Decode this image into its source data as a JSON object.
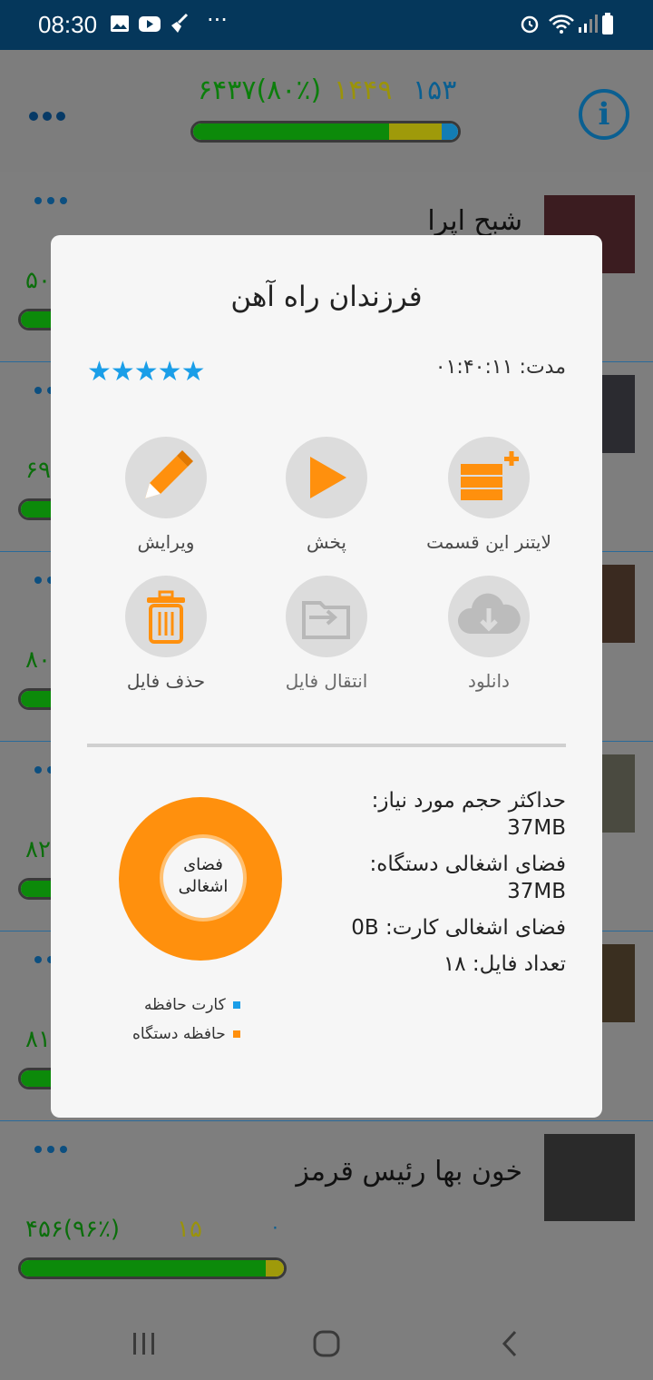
{
  "status_bar": {
    "time": "08:30",
    "overflow": "···"
  },
  "header": {
    "stat_green": "۶۴۳۷(۸۰٪)",
    "stat_yellow": "۱۴۴۹",
    "stat_blue": "۱۵۳",
    "progress": {
      "green": 0.74,
      "yellow": 0.2,
      "blue": 0.06
    }
  },
  "rows": [
    {
      "title": "شبح اپرا",
      "num": "۵۰"
    },
    {
      "title": "",
      "num": "۶۹"
    },
    {
      "title": "",
      "num": "۸۰"
    },
    {
      "title": "",
      "num": "۸۲"
    },
    {
      "title": "",
      "num": "۸۱"
    },
    {
      "title": "خون بها رئیس قرمز",
      "num": "۴۵۶(۹۶٪)",
      "yellow": "۱۵",
      "blue": "۰",
      "progress": {
        "green": 0.93,
        "yellow": 0.07
      }
    }
  ],
  "modal": {
    "title": "فرزندان راه آهن",
    "rating": 5,
    "duration_label": "مدت:",
    "duration_value": "۰۱:۴۰:۱۱",
    "actions": [
      {
        "label": "لایتنر این قسمت",
        "icon": "leitner-add-icon",
        "enabled": true
      },
      {
        "label": "پخش",
        "icon": "play-icon",
        "enabled": true
      },
      {
        "label": "ویرایش",
        "icon": "pencil-icon",
        "enabled": true
      },
      {
        "label": "دانلود",
        "icon": "cloud-download-icon",
        "enabled": false
      },
      {
        "label": "انتقال فایل",
        "icon": "folder-move-icon",
        "enabled": false
      },
      {
        "label": "حذف فایل",
        "icon": "trash-icon",
        "enabled": true
      }
    ],
    "info": {
      "max_size_label": "حداکثر حجم مورد نیاز:",
      "max_size_value": "37MB",
      "device_label": "فضای اشغالی دستگاه:",
      "device_value": "37MB",
      "card_label": "فضای اشغالی کارت:",
      "card_value": "0B",
      "files_label": "تعداد فایل:",
      "files_value": "۱۸"
    },
    "chart": {
      "center_line1": "فضای",
      "center_line2": "اشغالی",
      "legend": [
        {
          "label": "کارت حافظه",
          "color": "#1a9ee8"
        },
        {
          "label": "حافظه دستگاه",
          "color": "#ff900d"
        }
      ]
    }
  },
  "colors": {
    "accent": "#ff900d",
    "star": "#1a9ee8",
    "status_bar": "#05375b"
  }
}
